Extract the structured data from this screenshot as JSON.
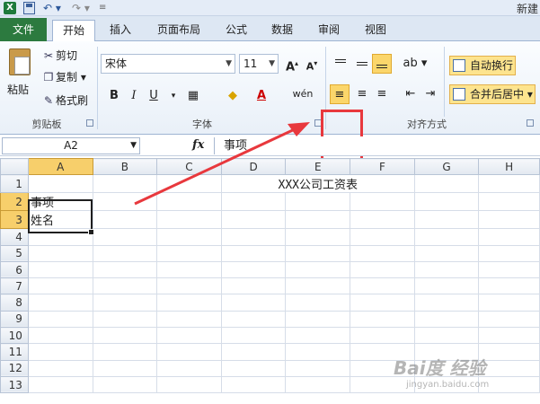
{
  "window": {
    "title": "新建"
  },
  "quick_access": {
    "more": "≡"
  },
  "tabs": [
    {
      "label": "文件"
    },
    {
      "label": "开始"
    },
    {
      "label": "插入"
    },
    {
      "label": "页面布局"
    },
    {
      "label": "公式"
    },
    {
      "label": "数据"
    },
    {
      "label": "审阅"
    },
    {
      "label": "视图"
    }
  ],
  "clipboard": {
    "paste": "粘贴",
    "cut": "剪切",
    "copy": "复制",
    "format_painter": "格式刷",
    "group_label": "剪贴板"
  },
  "font": {
    "name": "宋体",
    "size": "11",
    "grow": "A",
    "shrink": "A",
    "bold": "B",
    "italic": "I",
    "underline": "U",
    "wen": "wén",
    "group_label": "字体"
  },
  "alignment": {
    "wrap_text": "自动换行",
    "merge_center": "合并后居中",
    "group_label": "对齐方式"
  },
  "formula_bar": {
    "cell_ref": "A2",
    "fx": "fx",
    "content": "事项"
  },
  "sheet": {
    "columns": [
      "A",
      "B",
      "C",
      "D",
      "E",
      "F",
      "G",
      "H"
    ],
    "rows": [
      "1",
      "2",
      "3",
      "4",
      "5",
      "6",
      "7",
      "8",
      "9",
      "10",
      "11",
      "12",
      "13"
    ],
    "title_text": "XXX公司工资表",
    "a2": "事项",
    "a3": "姓名"
  },
  "watermark": {
    "line1": "Bai度 经验",
    "line2": "jingyan.baidu.com"
  },
  "colors": {
    "highlight": "#fbd66b",
    "annotation": "#e8383d",
    "file_tab": "#2c7a3f"
  }
}
